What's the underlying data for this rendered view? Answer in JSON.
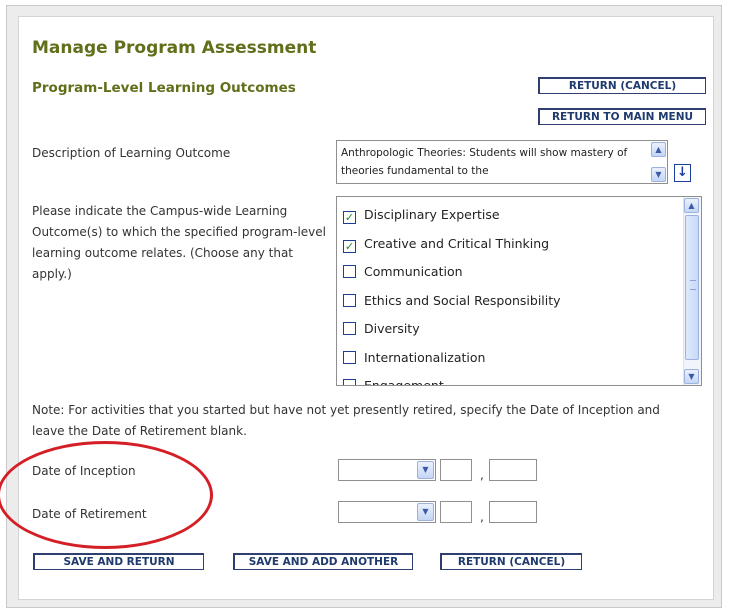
{
  "header": {
    "title": "Manage Program Assessment",
    "subtitle": "Program-Level Learning Outcomes"
  },
  "top_buttons": {
    "return_cancel": "RETURN (CANCEL)",
    "return_main_menu": "RETURN TO MAIN MENU"
  },
  "description": {
    "label": "Description of Learning Outcome",
    "value": "Anthropologic Theories: Students will show mastery of theories fundamental to the"
  },
  "campus_outcomes": {
    "label": "Please indicate the Campus-wide Learning Outcome(s) to which the specified program-level learning outcome relates. (Choose any that apply.)",
    "items": [
      {
        "label": "Disciplinary Expertise",
        "checked": true
      },
      {
        "label": "Creative and Critical Thinking",
        "checked": true
      },
      {
        "label": "Communication",
        "checked": false
      },
      {
        "label": "Ethics and Social Responsibility",
        "checked": false
      },
      {
        "label": "Diversity",
        "checked": false
      },
      {
        "label": "Internationalization",
        "checked": false
      },
      {
        "label": "Engagement",
        "checked": false
      }
    ]
  },
  "note": "Note: For activities that you started but have not yet presently retired, specify the Date of Inception and leave the Date of Retirement blank.",
  "dates": {
    "inception_label": "Date of Inception",
    "retirement_label": "Date of Retirement",
    "inception": {
      "month": "",
      "day": "",
      "year": ""
    },
    "retirement": {
      "month": "",
      "day": "",
      "year": ""
    },
    "separator": ","
  },
  "bottom_buttons": {
    "save_return": "SAVE AND RETURN",
    "save_add": "SAVE AND ADD ANOTHER",
    "return_cancel": "RETURN (CANCEL)"
  },
  "annotation_color": "#d41f26",
  "heading_color": "#5f6f1a"
}
